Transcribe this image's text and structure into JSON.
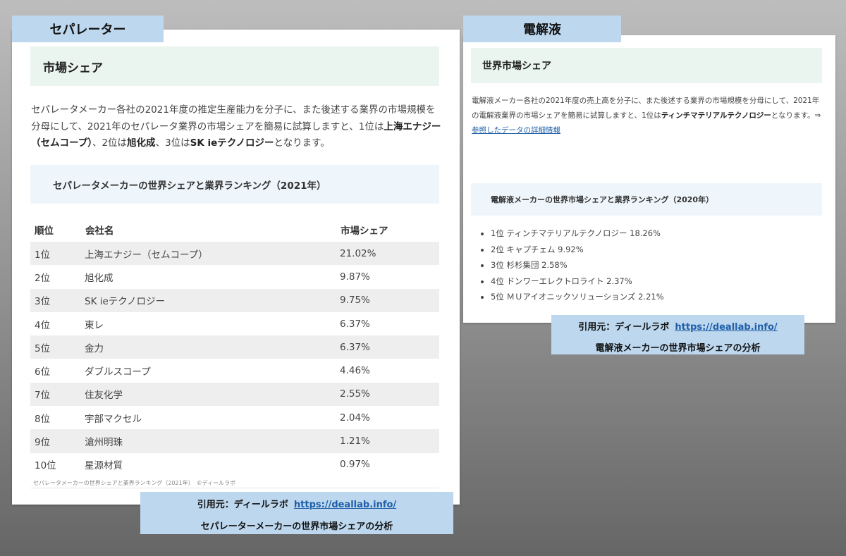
{
  "left": {
    "tag": "セパレーター",
    "heading": "市場シェア",
    "intro": {
      "t1": "セパレータメーカー各社の2021年度の推定生産能力を分子に、また後述する業界の市場規模を分母にして、2021年のセパレータ業界の市場シェアを簡易に試算しますと、1位は",
      "b1": "上海エナジー（セムコープ）",
      "t2": "、2位は",
      "b2": "旭化成",
      "t3": "、3位は",
      "b3": "SK ieテクノロジー",
      "t4": "となります。"
    },
    "table_caption": "セパレータメーカーの世界シェアと業界ランキング（2021年）",
    "columns": [
      "順位",
      "会社名",
      "市場シェア"
    ],
    "rows": [
      {
        "rank": "1位",
        "company": "上海エナジー（セムコープ）",
        "share": "21.02%"
      },
      {
        "rank": "2位",
        "company": "旭化成",
        "share": "9.87%"
      },
      {
        "rank": "3位",
        "company": "SK ieテクノロジー",
        "share": "9.75%"
      },
      {
        "rank": "4位",
        "company": "東レ",
        "share": "6.37%"
      },
      {
        "rank": "5位",
        "company": "金力",
        "share": "6.37%"
      },
      {
        "rank": "6位",
        "company": "ダブルスコープ",
        "share": "4.46%"
      },
      {
        "rank": "7位",
        "company": "住友化学",
        "share": "2.55%"
      },
      {
        "rank": "8位",
        "company": "宇部マクセル",
        "share": "2.04%"
      },
      {
        "rank": "9位",
        "company": "滄州明珠",
        "share": "1.21%"
      },
      {
        "rank": "10位",
        "company": "星源材質",
        "share": "0.97%"
      }
    ],
    "credit": "セパレータメーカーの世界シェアと業界ランキング（2021年）　©ディールラボ",
    "source": {
      "prefix": "引用元：ディールラボ",
      "url": "https://deallab.info/",
      "title": "セパレーターメーカーの世界市場シェアの分析"
    }
  },
  "right": {
    "tag": "電解液",
    "heading": "世界市場シェア",
    "intro": {
      "t1": "電解液メーカー各社の2021年度の売上高を分子に、また後述する業界の市場規模を分母にして、2021年の電解液業界の市場シェアを簡易に試算しますと、1位は",
      "b1": "ティンチマテリアルテクノロジー",
      "t2": "となります。⇒",
      "link": "参照したデータの詳細情報"
    },
    "list_caption": "電解液メーカーの世界市場シェアと業界ランキング（2020年）",
    "items": [
      "1位 ティンチマテリアルテクノロジー 18.26%",
      "2位 キャプチェム 9.92%",
      "3位 杉杉集団 2.58%",
      "4位 ドンワーエレクトロライト 2.37%",
      "5位 ＭＵアイオニックソリューションズ 2.21%"
    ],
    "source": {
      "prefix": "引用元：ディールラボ",
      "url": "https://deallab.info/",
      "title": "電解液メーカーの世界市場シェアの分析"
    }
  }
}
